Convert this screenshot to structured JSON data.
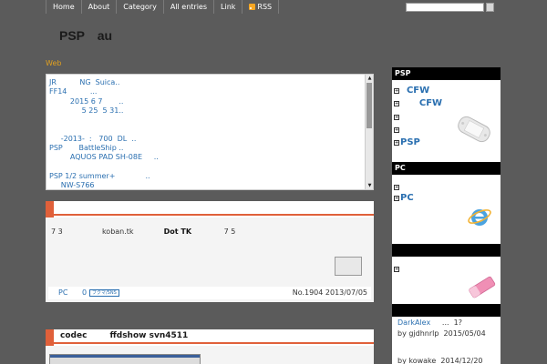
{
  "nav": {
    "items": [
      "Home",
      "About",
      "Category",
      "All entries",
      "Link"
    ],
    "rss": "RSS"
  },
  "site": {
    "title": "PSP　au",
    "web_label": "Web"
  },
  "news": {
    "lines": [
      "JR          NG  Suica..",
      "FF14          ...",
      "         2015 6 7       ..",
      "              5 25  5 31..",
      "",
      "",
      "     -2013-  :   700  DL  ..",
      "PSP       BattleShip ..",
      "         AQUOS PAD SH-08E     ..",
      "",
      "PSP 1/2 summer+             ..",
      "     NW-S766"
    ]
  },
  "post1": {
    "title": "",
    "body_prefix": "7 3                 koban.tk             ",
    "body_bold": "Dot TK",
    "body_suffix": "              7 5",
    "footer": {
      "category": "PC",
      "count": "0",
      "bookmark": "ブクマ/SNS",
      "meta": "No.1904  2013/07/05"
    }
  },
  "post2": {
    "title": "codec        ffdshow svn4511"
  },
  "sidebar": {
    "psp": {
      "heading": "PSP",
      "items": [
        "  CFW",
        "      CFW",
        "",
        "",
        "PSP"
      ]
    },
    "pc": {
      "heading": "PC",
      "items": [
        "",
        "PC"
      ]
    },
    "other": {
      "heading": "",
      "items": [
        ""
      ]
    },
    "comments": {
      "heading": "",
      "lines": [
        {
          "link": "DarkAlex",
          "text": "     ...  1?"
        },
        {
          "link": "",
          "text": "by gjdhnrlp  2015/05/04"
        },
        {
          "link": "",
          "text": ""
        },
        {
          "link": "",
          "text": "by kowake  2014/12/20"
        }
      ]
    }
  },
  "colors": {
    "accent": "#e0603a",
    "link": "#2a6fb0",
    "web": "#e0a020",
    "background": "#5b5b5b"
  }
}
